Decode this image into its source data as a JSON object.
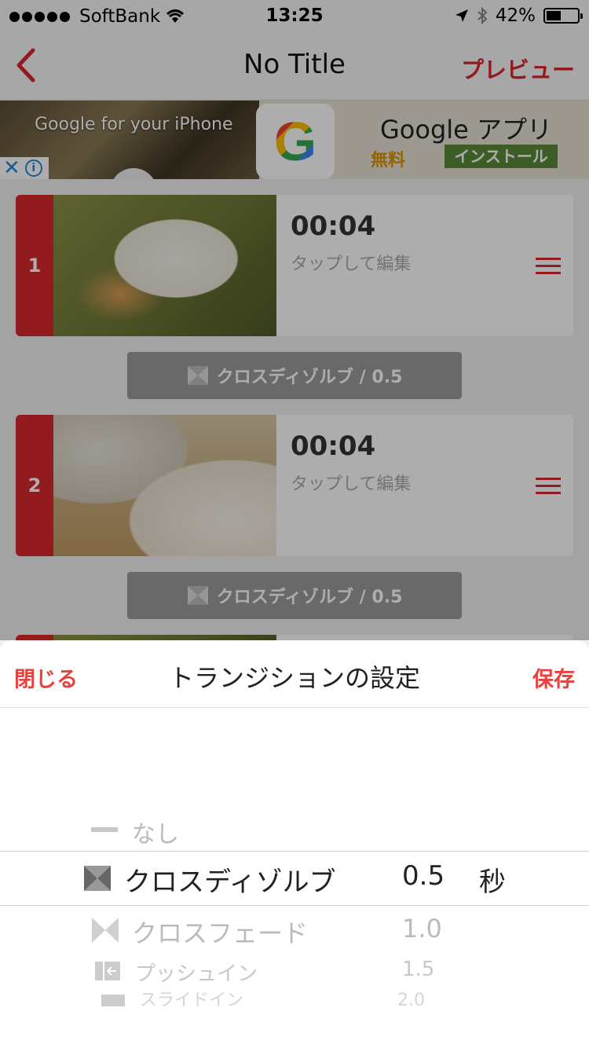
{
  "status_bar": {
    "carrier": "SoftBank",
    "time": "13:25",
    "battery": "42%"
  },
  "nav": {
    "title": "No Title",
    "preview_label": "プレビュー"
  },
  "ad": {
    "tagline": "Google for your iPhone",
    "logo_letter": "G",
    "app_name": "Google アプリ",
    "price": "無料",
    "install_label": "インストール"
  },
  "clips": [
    {
      "number": "1",
      "duration": "00:04",
      "hint": "タップして編集"
    },
    {
      "number": "2",
      "duration": "00:04",
      "hint": "タップして編集"
    }
  ],
  "transitions": [
    {
      "label": "クロスディゾルブ / 0.5"
    },
    {
      "label": "クロスディゾルブ / 0.5"
    }
  ],
  "sheet": {
    "close_label": "閉じる",
    "title": "トランジションの設定",
    "save_label": "保存",
    "picker_types": [
      {
        "label": "なし",
        "icon": "dash-icon"
      },
      {
        "label": "クロスディゾルブ",
        "icon": "cross-dissolve-icon"
      },
      {
        "label": "クロスフェード",
        "icon": "cross-fade-icon"
      },
      {
        "label": "プッシュイン",
        "icon": "push-in-icon"
      },
      {
        "label": "スライドイン",
        "icon": "slide-in-icon"
      }
    ],
    "picker_durations": [
      "0.5",
      "1.0",
      "1.5",
      "2.0"
    ],
    "unit": "秒"
  },
  "colors": {
    "accent": "#d7282f",
    "sheet_accent": "#e8423f",
    "install_green": "#5a8a38"
  }
}
